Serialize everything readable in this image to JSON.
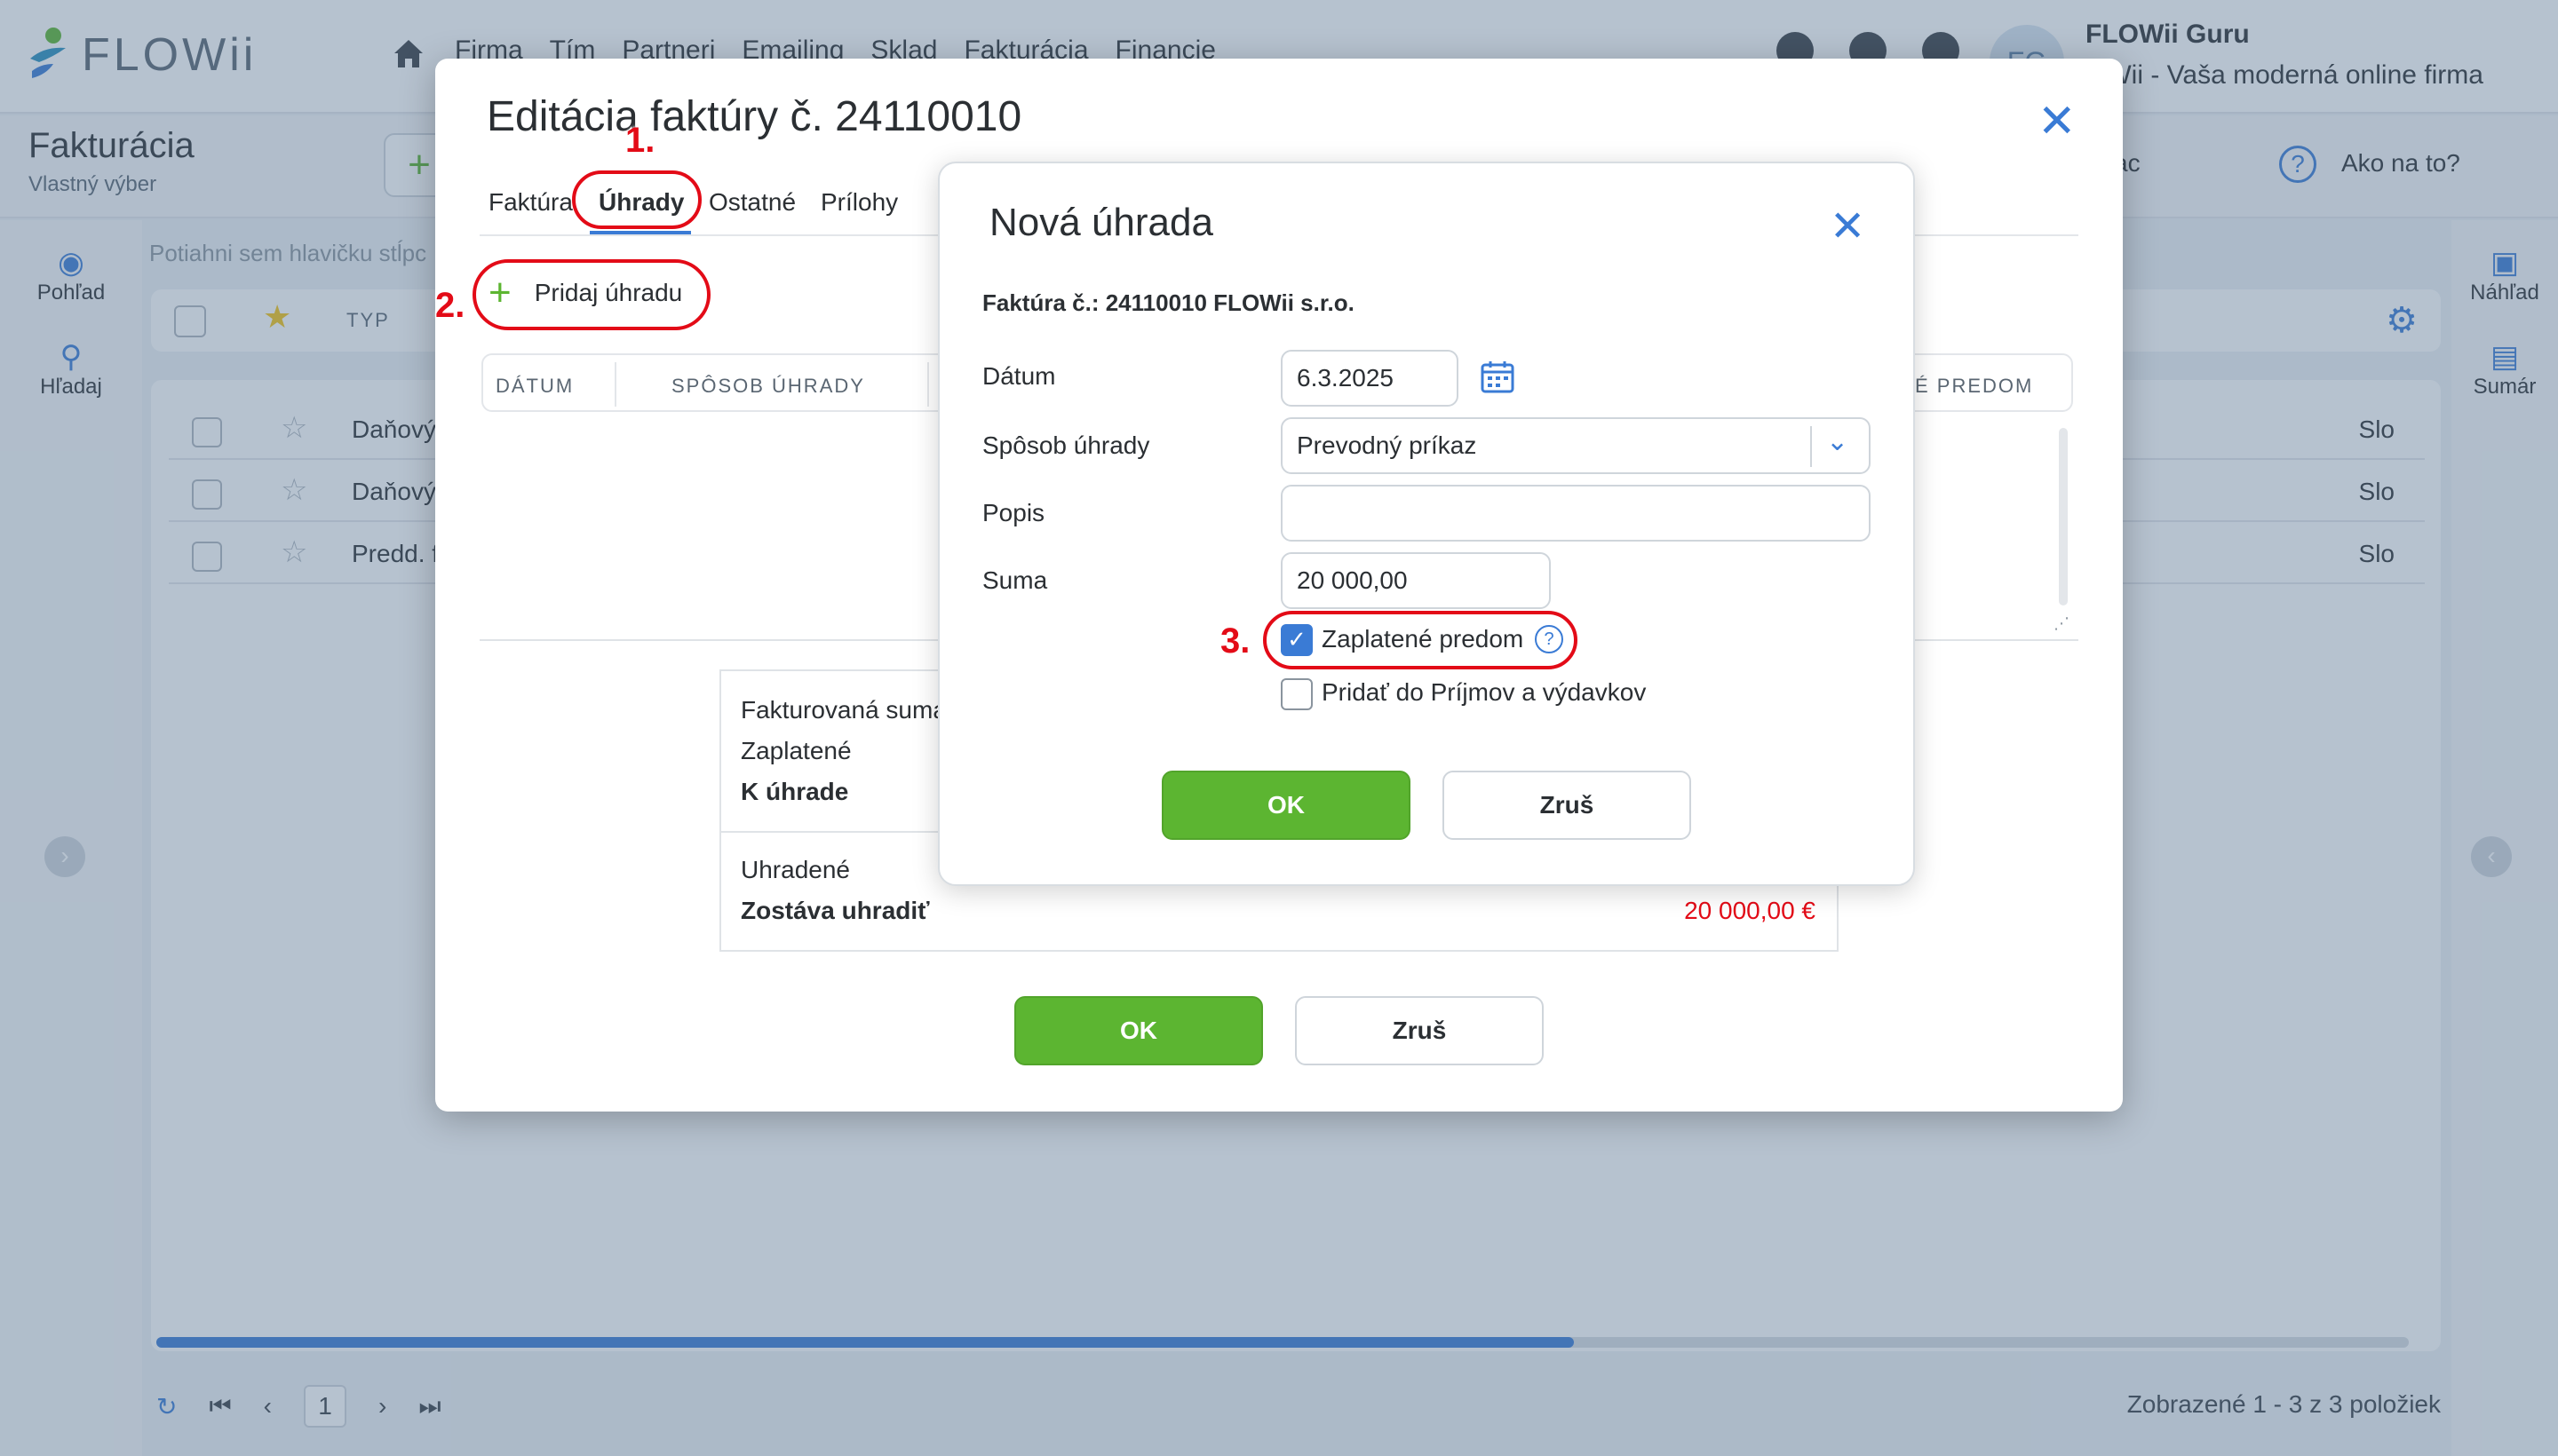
{
  "app": {
    "logo_text": "FLOWii",
    "nav": [
      "Firma",
      "Tím",
      "Partneri",
      "Emailing",
      "Sklad",
      "Fakturácia",
      "Financie"
    ],
    "user_initials": "FG",
    "user_name": "FLOWii Guru",
    "user_subtitle": "OWii - Vaša moderná online firma",
    "page_title": "Fakturácia",
    "page_subtitle": "Vlastný výber",
    "add_label": "+",
    "sub_right_1": "ac",
    "sub_right_2": "Ako na to?",
    "left_sidebar": [
      {
        "label": "Pohľad",
        "icon": "eye-icon"
      },
      {
        "label": "Hľadaj",
        "icon": "search-icon"
      }
    ],
    "right_sidebar": [
      {
        "label": "Náhľad",
        "icon": "preview-icon"
      },
      {
        "label": "Sumár",
        "icon": "summary-icon"
      }
    ],
    "drag_hint": "Potiahni sem hlavičku stĺpc",
    "filter_type_label": "TYP",
    "rows": [
      {
        "text": "Daňový",
        "right": "Slo"
      },
      {
        "text": "Daňový",
        "right": "Slo"
      },
      {
        "text": "Predd. f",
        "right": "Slo"
      }
    ],
    "pager": {
      "page": "1",
      "info": "Zobrazené 1 - 3 z 3 položiek"
    }
  },
  "dialog": {
    "title": "Editácia faktúry č. 24110010",
    "tabs": [
      "Faktúra",
      "Úhrady",
      "Ostatné",
      "Prílohy"
    ],
    "active_tab": "Úhrady",
    "add_payment": "Pridaj úhradu",
    "table_headers": [
      "DÁTUM",
      "SPÔSOB ÚHRADY",
      "É PREDOM"
    ],
    "summary": {
      "invoiced": "Fakturovaná suma",
      "paid": "Zaplatené",
      "to_pay": "K úhrade",
      "settled": "Uhradené",
      "remaining": "Zostáva uhradiť",
      "remaining_value": "20 000,00 €"
    },
    "ok": "OK",
    "cancel": "Zruš"
  },
  "payment_dialog": {
    "title": "Nová úhrada",
    "invoice_line": "Faktúra č.: 24110010 FLOWii s.r.o.",
    "date_label": "Dátum",
    "date_value": "6.3.2025",
    "method_label": "Spôsob úhrady",
    "method_value": "Prevodný príkaz",
    "desc_label": "Popis",
    "desc_value": "",
    "amount_label": "Suma",
    "amount_value": "20 000,00",
    "prepaid_label": "Zaplatené predom",
    "prepaid_checked": true,
    "add_income_label": "Pridať do Príjmov a výdavkov",
    "add_income_checked": false,
    "ok": "OK",
    "cancel": "Zruš"
  },
  "annotations": [
    "1.",
    "2.",
    "3."
  ],
  "colors": {
    "accent_blue": "#3a7bd5",
    "ok_green": "#5cb531",
    "annotation_red": "#e30b17",
    "remaining_red": "#e30b17"
  }
}
